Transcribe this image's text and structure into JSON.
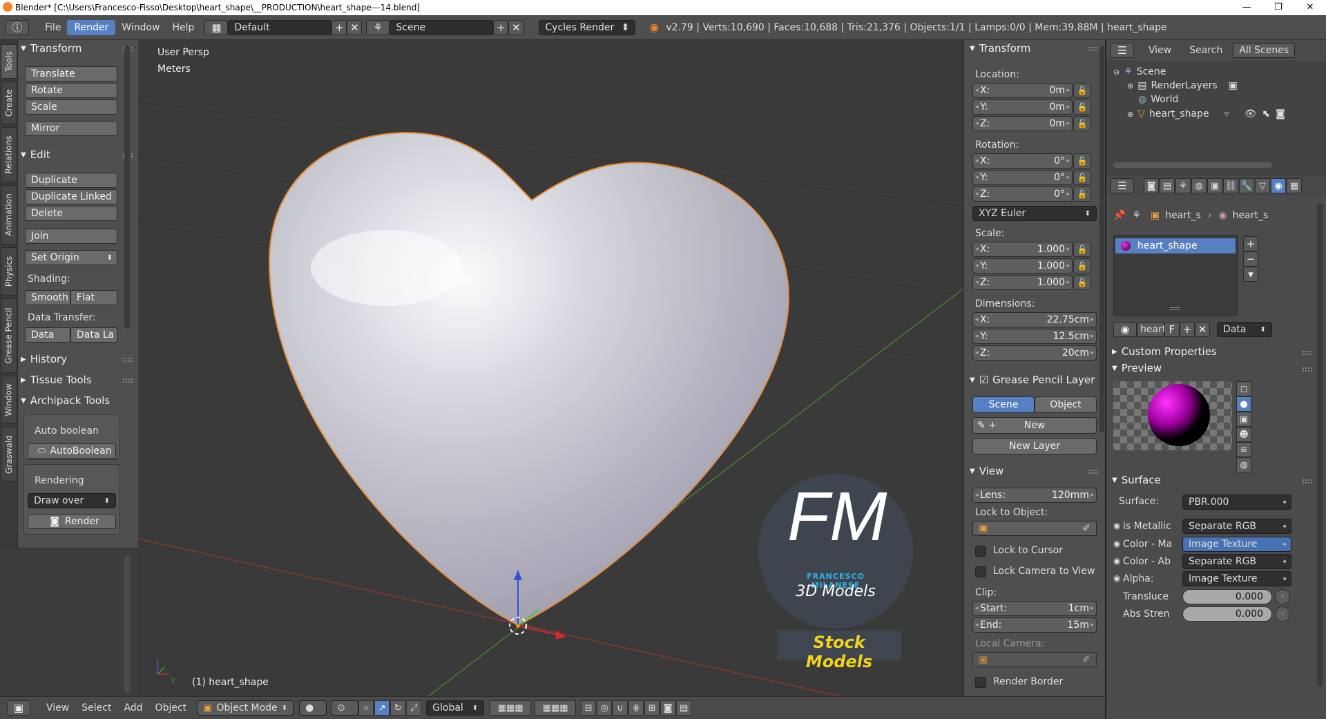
{
  "window": {
    "title": "Blender* [C:\\Users\\Francesco-Fisso\\Desktop\\heart_shape\\__PRODUCTION\\heart_shape---14.blend]"
  },
  "menus": [
    "File",
    "Render",
    "Window",
    "Help"
  ],
  "menu_active": "Render",
  "layout_name": "Default",
  "scene_name": "Scene",
  "render_engine": "Cycles Render",
  "stats": "v2.79 | Verts:10,690 | Faces:10,688 | Tris:21,376 | Objects:1/1 | Lamps:0/0 | Mem:39.88M | heart_shape",
  "vertical_tabs": [
    "Tools",
    "Create",
    "Relations",
    "Animation",
    "Physics",
    "Grease Pencil",
    "Window",
    "Graswald"
  ],
  "toolshelf": {
    "transform_title": "Transform",
    "translate": "Translate",
    "rotate": "Rotate",
    "scale": "Scale",
    "mirror": "Mirror",
    "edit_title": "Edit",
    "duplicate": "Duplicate",
    "duplicate_linked": "Duplicate Linked",
    "delete": "Delete",
    "join": "Join",
    "set_origin": "Set Origin",
    "shading_label": "Shading:",
    "smooth": "Smooth",
    "flat": "Flat",
    "data_transfer_label": "Data Transfer:",
    "data": "Data",
    "data_la": "Data La",
    "history": "History",
    "tissue_tools": "Tissue Tools",
    "archipack": "Archipack Tools",
    "auto_boolean_label": "Auto boolean",
    "autoboolean_btn": "AutoBoolean",
    "rendering_label": "Rendering",
    "draw_over": "Draw over",
    "render_btn": "Render"
  },
  "viewport": {
    "persp": "User Persp",
    "units": "Meters",
    "object_label": "(1) heart_shape",
    "watermark_fm": "FM",
    "watermark_name": "FRANCESCO MILANESE",
    "watermark_3d": "3D Models",
    "watermark_stock": "Stock Models"
  },
  "npanel": {
    "transform_title": "Transform",
    "location_label": "Location:",
    "location": {
      "x": "0m",
      "y": "0m",
      "z": "0m"
    },
    "rotation_label": "Rotation:",
    "rotation": {
      "x": "0°",
      "y": "0°",
      "z": "0°"
    },
    "rotation_mode": "XYZ Euler",
    "scale_label": "Scale:",
    "scale": {
      "x": "1.000",
      "y": "1.000",
      "z": "1.000"
    },
    "dimensions_label": "Dimensions:",
    "dimensions": {
      "x": "22.75cm",
      "y": "12.5cm",
      "z": "20cm"
    },
    "axis": {
      "x": "X:",
      "y": "Y:",
      "z": "Z:"
    },
    "gp_title": "Grease Pencil Layer",
    "gp_scene": "Scene",
    "gp_object": "Object",
    "gp_new": "New",
    "gp_new_layer": "New Layer",
    "view_title": "View",
    "lens_label": "Lens:",
    "lens_value": "120mm",
    "lock_object_label": "Lock to Object:",
    "lock_cursor": "Lock to Cursor",
    "lock_camera": "Lock Camera to View",
    "clip_label": "Clip:",
    "clip_start_label": "Start:",
    "clip_start": "1cm",
    "clip_end_label": "End:",
    "clip_end": "15m",
    "local_camera_label": "Local Camera:",
    "render_border": "Render Border"
  },
  "outliner": {
    "view": "View",
    "search": "Search",
    "scope": "All Scenes",
    "items": [
      "Scene",
      "RenderLayers",
      "World",
      "heart_shape"
    ]
  },
  "properties": {
    "breadcrumb_1": "heart_s",
    "breadcrumb_2": "heart_s",
    "material_slot": "heart_shape",
    "mat_name": "heart",
    "mat_f": "F",
    "mat_data": "Data",
    "custom_props": "Custom Properties",
    "preview": "Preview",
    "surface_title": "Surface",
    "surface_label": "Surface:",
    "surface_value": "PBR.000",
    "rows": [
      {
        "label": "is Metallic",
        "value": "Separate RGB"
      },
      {
        "label": "Color - Ma",
        "value": "Image Texture"
      },
      {
        "label": "Color - Ab",
        "value": "Separate RGB"
      },
      {
        "label": "Alpha:",
        "value": "Image Texture"
      }
    ],
    "translucent_label": "Transluce",
    "translucent_value": "0.000",
    "abs_label": "Abs Stren",
    "abs_value": "0.000"
  },
  "bottombar": {
    "view": "View",
    "select": "Select",
    "add": "Add",
    "object": "Object",
    "mode": "Object Mode",
    "orientation": "Global"
  },
  "colors": {
    "selection_outline": "#e8892b",
    "accent_blue": "#5680c2",
    "watermark_cyan": "#2ab4e6",
    "watermark_yellow": "#f2d21b"
  }
}
